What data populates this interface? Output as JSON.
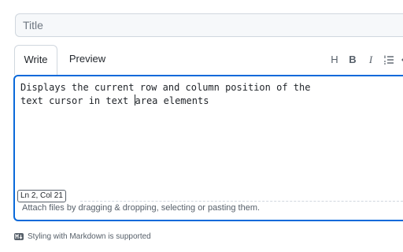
{
  "title_field": {
    "placeholder": "Title",
    "value": ""
  },
  "tabs": [
    {
      "label": "Write",
      "active": true
    },
    {
      "label": "Preview",
      "active": false
    }
  ],
  "toolbar": [
    {
      "icon": "heading-icon",
      "glyph": "H"
    },
    {
      "icon": "bold-icon",
      "glyph": "B"
    },
    {
      "icon": "italic-icon",
      "glyph": "I"
    },
    {
      "icon": "ordered-list-icon"
    },
    {
      "icon": "code-icon"
    }
  ],
  "editor": {
    "line1": "Displays the current row and column position of the",
    "line2_before_cursor": "text cursor in text ",
    "line2_after_cursor": "area elements",
    "cursor_position_label": "Ln 2, Col 21",
    "attach_hint": "Attach files by dragging & dropping, selecting or pasting them."
  },
  "footer": {
    "markdown_note": "Styling with Markdown is supported"
  },
  "colors": {
    "focus_border": "#0969da",
    "border": "#d0d7de",
    "muted_text": "#57606a"
  }
}
